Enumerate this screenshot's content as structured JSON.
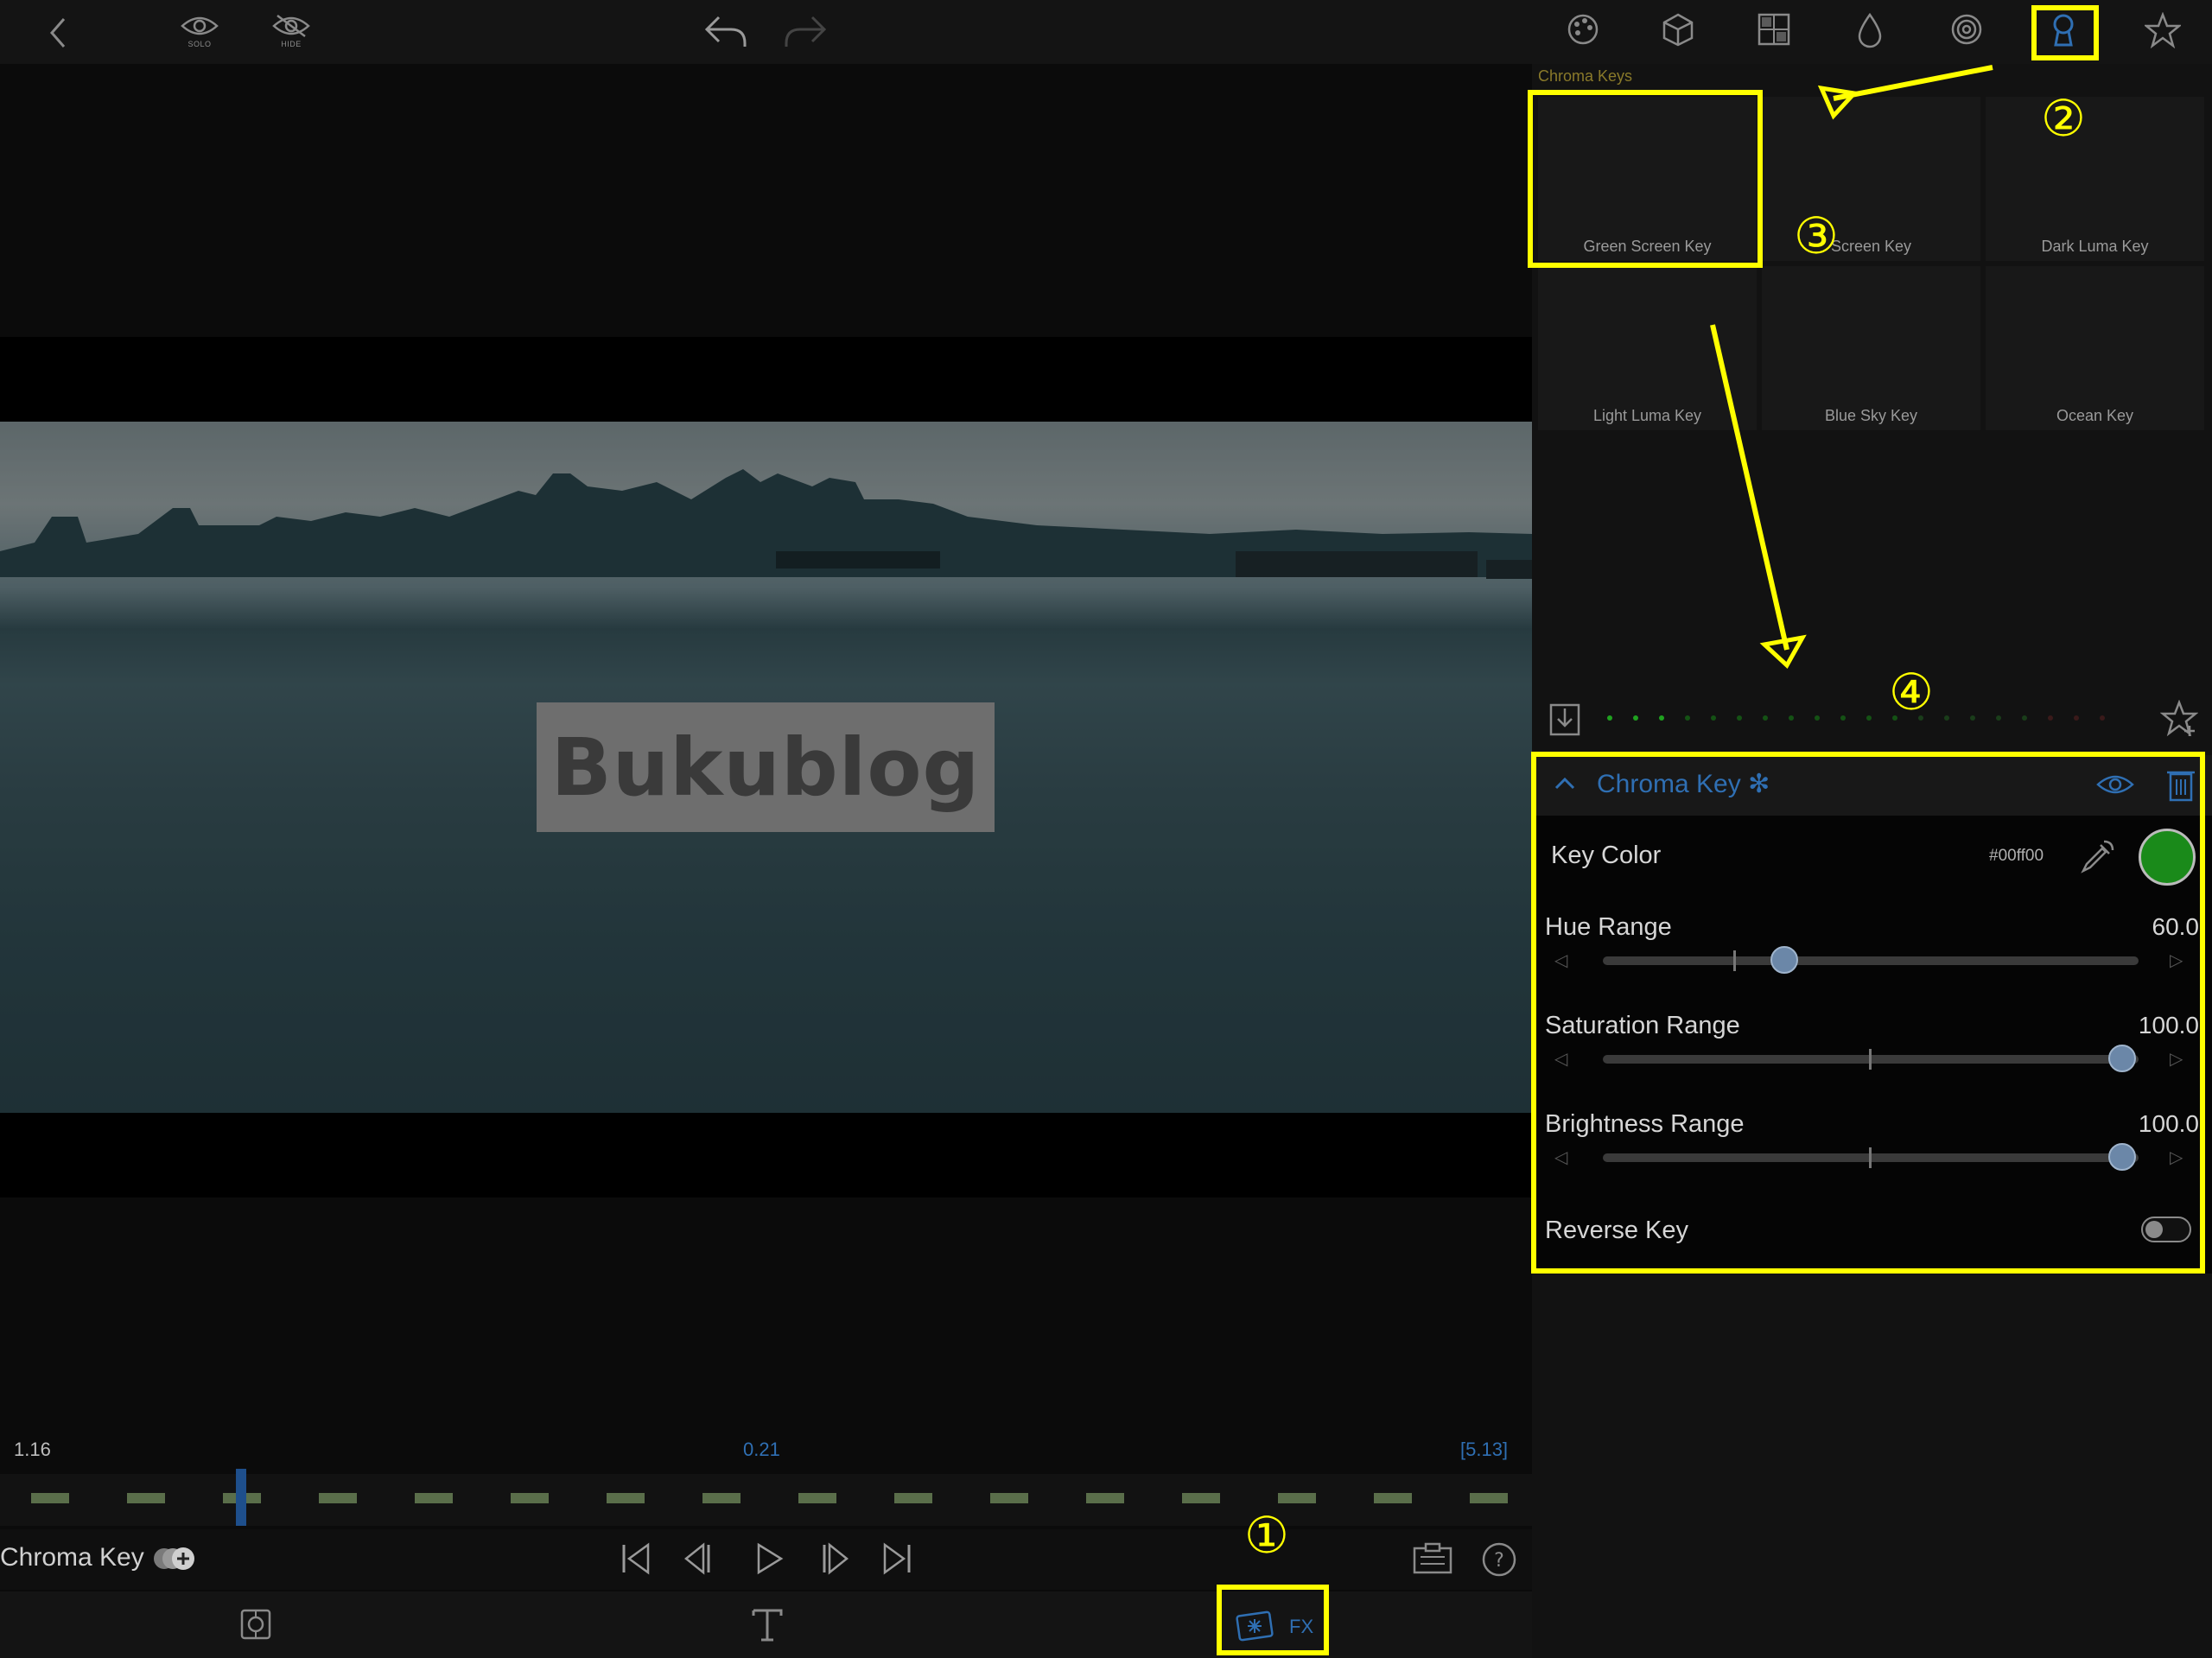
{
  "topbar": {
    "solo_label": "SOLO",
    "hide_label": "HIDE"
  },
  "preview": {
    "title_text": "Bukublog"
  },
  "timeline": {
    "left_time": "1.16",
    "current_time": "0.21",
    "total_time": "[5.13]",
    "clip_count": 16
  },
  "transport": {
    "effect_label": "Chroma Key"
  },
  "bottom": {
    "fx_label": "FX"
  },
  "presets": {
    "section_title": "Chroma Keys",
    "items": [
      {
        "label": "Green Screen Key"
      },
      {
        "label": "Screen Key"
      },
      {
        "label": "Dark Luma Key"
      },
      {
        "label": "Light Luma Key"
      },
      {
        "label": "Blue Sky Key"
      },
      {
        "label": "Ocean Key"
      }
    ]
  },
  "chroma_key": {
    "title": "Chroma Key ✻",
    "key_color_label": "Key Color",
    "key_color_hex": "#00ff00",
    "key_color_swatch": "#1a8a1a",
    "hue_range_label": "Hue Range",
    "hue_range_value": "60.0",
    "hue_range_fraction": 0.35,
    "saturation_range_label": "Saturation Range",
    "saturation_range_value": "100.0",
    "saturation_range_fraction": 1.0,
    "brightness_range_label": "Brightness Range",
    "brightness_range_value": "100.0",
    "brightness_range_fraction": 1.0,
    "reverse_key_label": "Reverse Key",
    "reverse_key_on": false
  },
  "annotations": {
    "step1": "①",
    "step2": "②",
    "step3": "③",
    "step4": "④"
  },
  "colors": {
    "accent_blue": "#2f6fb3",
    "annotation_yellow": "#ffff00",
    "section_title": "#8a7a2a"
  },
  "icons": [
    "back-icon",
    "solo-eye-icon",
    "hide-eye-icon",
    "undo-icon",
    "redo-icon",
    "palette-icon",
    "cube-icon",
    "grid-icon",
    "drop-icon",
    "spiral-icon",
    "keyhole-icon",
    "star-icon",
    "download-icon",
    "favorite-add-icon",
    "visibility-icon",
    "trash-icon",
    "eyedropper-icon",
    "skip-start-icon",
    "step-back-icon",
    "play-icon",
    "step-forward-icon",
    "skip-end-icon",
    "clipboard-icon",
    "help-icon",
    "target-icon",
    "text-icon",
    "fx-icon"
  ]
}
